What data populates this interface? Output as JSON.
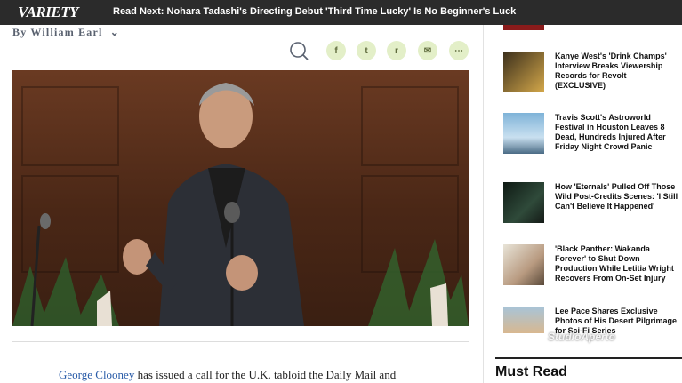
{
  "header": {
    "logo": "VARIETY",
    "read_next": "Read Next: Nohara Tadashi's Directing Debut 'Third Time Lucky' Is No Beginner's Luck"
  },
  "article": {
    "byline": "By William Earl",
    "share": {
      "facebook": "f",
      "twitter": "t",
      "reddit": "r",
      "email": "✉",
      "more": "⋯"
    },
    "body_link": "George Clooney",
    "body_rest": " has issued a call for the U.K. tabloid the Daily Mail and"
  },
  "sidebar": {
    "items": [
      {
        "title": "Kanye West's 'Drink Champs' Interview Breaks Viewership Records for Revolt (EXCLUSIVE)"
      },
      {
        "title": "Travis Scott's Astroworld Festival in Houston Leaves 8 Dead, Hundreds Injured After Friday Night Crowd Panic"
      },
      {
        "title": "How 'Eternals' Pulled Off Those Wild Post-Credits Scenes: 'I Still Can't Believe It Happened'"
      },
      {
        "title": "'Black Panther: Wakanda Forever' to Shut Down Production While Letitia Wright Recovers From On-Set Injury"
      },
      {
        "title": "Lee Pace Shares Exclusive Photos of His Desert Pilgrimage for Sci-Fi Series"
      }
    ],
    "must_read": "Must Read"
  },
  "watermark": "StudioAperto",
  "colors": {
    "topbar": "#2b2b2b",
    "link": "#2a5ca8",
    "share_bg": "#e3efc8"
  }
}
